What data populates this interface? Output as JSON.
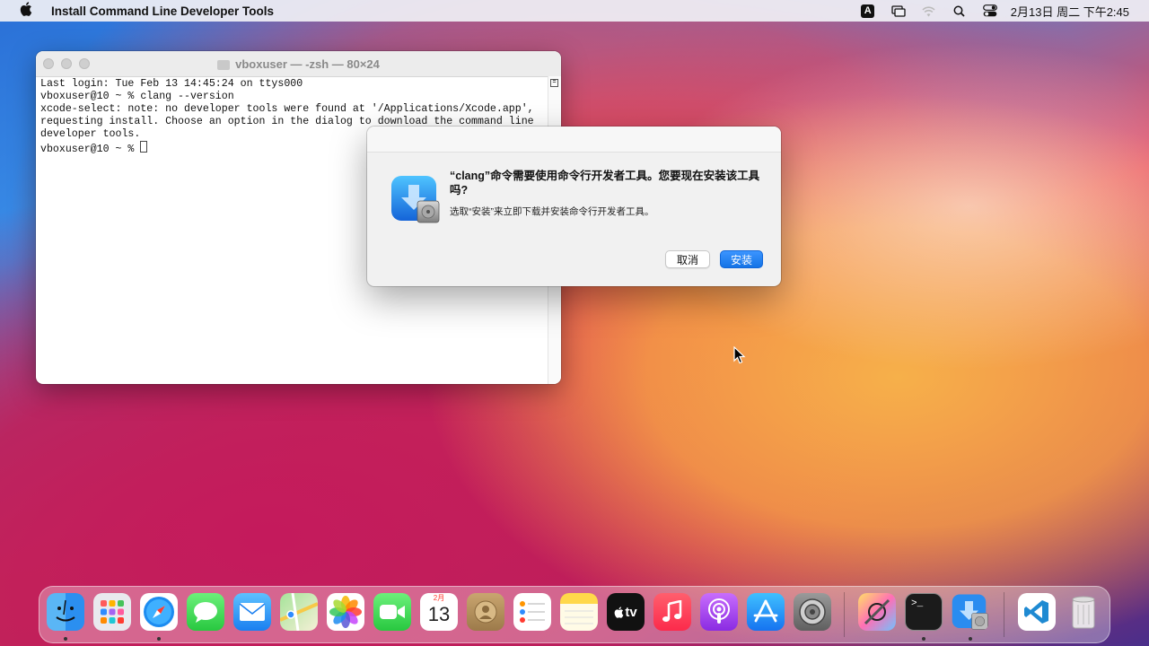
{
  "menubar": {
    "app_name": "Install Command Line Developer Tools",
    "input_indicator": "A",
    "clock": "2月13日 周二 下午2:45"
  },
  "terminal": {
    "title": "vboxuser — -zsh — 80×24",
    "lines": [
      "Last login: Tue Feb 13 14:45:24 on ttys000",
      "vboxuser@10 ~ % clang --version",
      "xcode-select: note: no developer tools were found at '/Applications/Xcode.app',",
      "requesting install. Choose an option in the dialog to download the command line",
      "developer tools.",
      "vboxuser@10 ~ % "
    ]
  },
  "dialog": {
    "title": "“clang”命令需要使用命令行开发者工具。您要现在安装该工具吗?",
    "message": "选取“安装”来立即下载并安装命令行开发者工具。",
    "cancel_label": "取消",
    "install_label": "安装"
  },
  "dock": {
    "calendar_month": "2月",
    "calendar_day": "13",
    "tv_label": "tv"
  }
}
